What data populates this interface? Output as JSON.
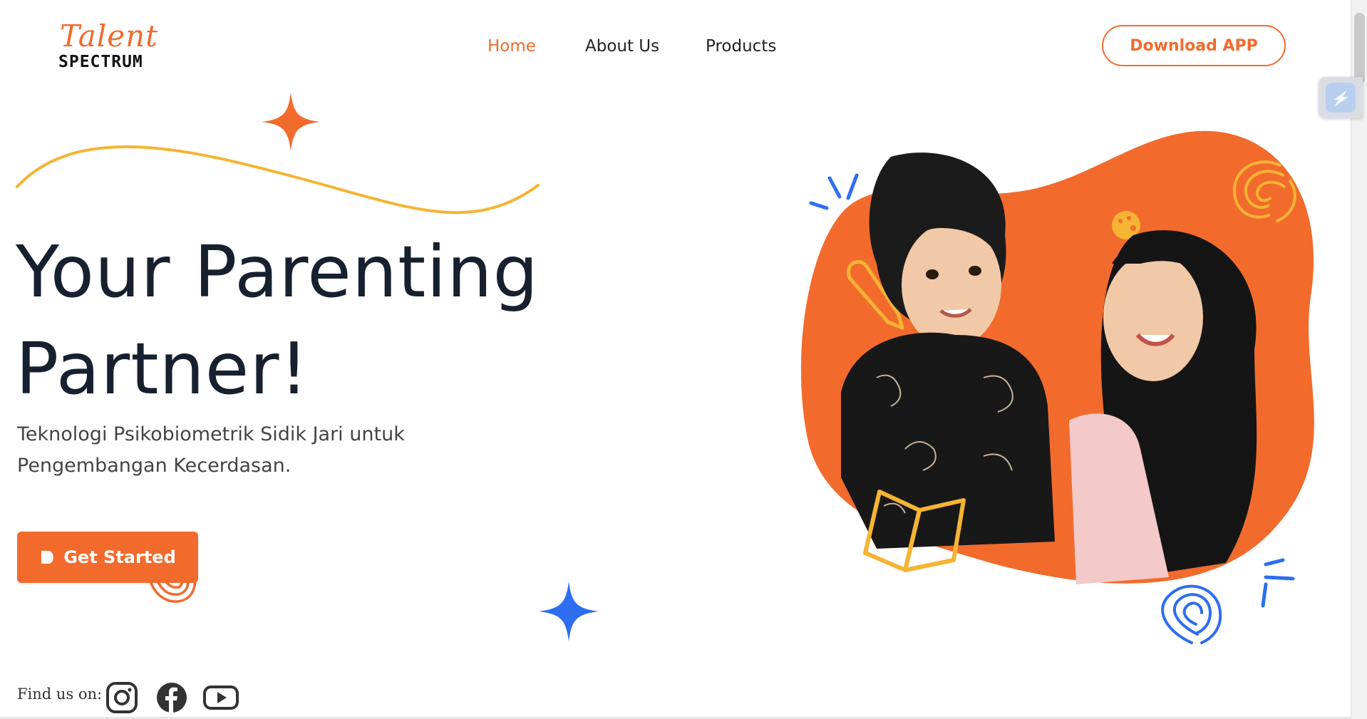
{
  "brand": {
    "script": "Talent",
    "word": "SPECTRUM",
    "accent_color": "#f26b2d",
    "blue_color": "#2d6ef0",
    "yellow_color": "#f5b433"
  },
  "nav": {
    "items": [
      {
        "label": "Home",
        "active": true
      },
      {
        "label": "About Us",
        "active": false
      },
      {
        "label": "Products",
        "active": false
      }
    ],
    "download_label": "Download APP"
  },
  "hero": {
    "title_line1": "Your Parenting",
    "title_line2": "Partner!",
    "subtitle_line1": "Teknologi Psikobiometrik Sidik Jari untuk",
    "subtitle_line2": "Pengembangan Kecerdasan.",
    "cta_label": "Get Started"
  },
  "footer": {
    "find_label": "Find us on:",
    "social": [
      {
        "icon": "instagram-icon"
      },
      {
        "icon": "facebook-icon"
      },
      {
        "icon": "youtube-icon"
      }
    ]
  }
}
